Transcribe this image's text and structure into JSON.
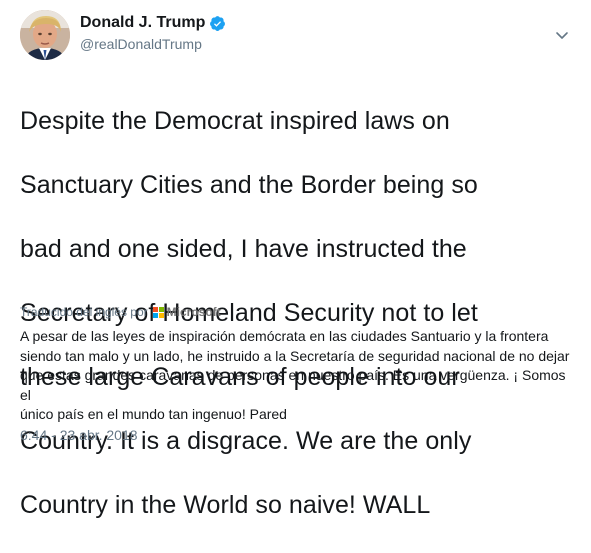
{
  "author": {
    "display_name": "Donald J. Trump",
    "handle": "@realDonaldTrump",
    "verified": true,
    "avatar_icon": "profile-photo"
  },
  "tweet": {
    "text_lines": [
      "Despite the Democrat inspired laws on",
      "Sanctuary Cities and the Border being so",
      "bad and one sided, I have instructed the",
      "Secretary of Homeland Security not to let",
      "these large Caravans of people into our",
      "Country. It is a disgrace. We are the only",
      "Country in the World so naive! WALL"
    ]
  },
  "translation": {
    "label": "Traducido del inglés por",
    "provider": "Microsoft",
    "provider_colors": [
      "#f25022",
      "#7fba00",
      "#00a4ef",
      "#ffb900"
    ],
    "lines": [
      "A pesar de las leyes de inspiración demócrata en las ciudades Santuario y la frontera",
      "siendo tan malo y un lado, he instruido a la Secretaría de seguridad nacional de no dejar",
      "que estas grandes caravanas de personas en nuestro país. Es una vergüenza. ¡ Somos el",
      "único país en el mundo tan ingenuo! Pared"
    ]
  },
  "meta": {
    "timestamp": "6:44 - 23 abr. 2018"
  },
  "colors": {
    "verified_blue": "#1da1f2",
    "secondary_text": "#657786",
    "primary_text": "#14171a"
  },
  "icons": {
    "verified": "verified-badge-icon",
    "menu": "chevron-down-icon"
  }
}
